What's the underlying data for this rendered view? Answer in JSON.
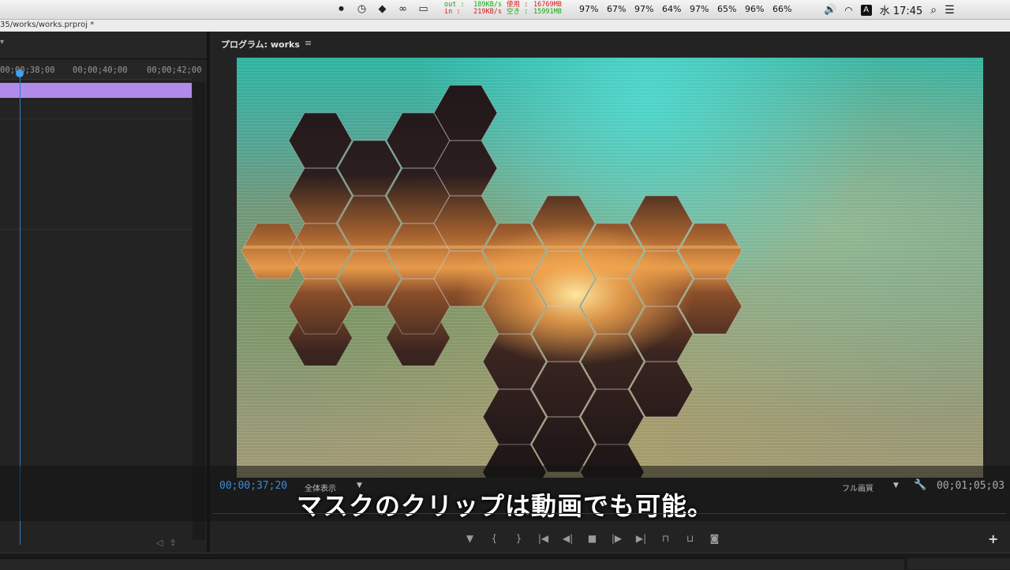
{
  "menubar": {
    "icons": [
      "record-icon",
      "clock-icon",
      "evernote-icon",
      "creative-cloud-icon",
      "airplay-icon"
    ],
    "net_out_label": "out :",
    "net_in_label": "in :",
    "net_out": "189KB/s",
    "net_in": "219KB/s",
    "mem_used_label": "使用 :",
    "mem_free_label": "空き :",
    "mem_used": "16769MB",
    "mem_free": "15991MB",
    "percents": [
      "97%",
      "67%",
      "97%",
      "64%",
      "97%",
      "65%",
      "96%",
      "66%"
    ],
    "input_badge": "A",
    "clock": "水 17:45"
  },
  "titlebar": {
    "path": "35/works/works.prproj *"
  },
  "timeline": {
    "ticks": [
      "00;00;38;00",
      "00;00;40;00",
      "00;00;42;00"
    ]
  },
  "program": {
    "title": "プログラム: works",
    "menu_icon": "≡",
    "timecode_current": "00;00;37;20",
    "fit": "全体表示",
    "quality": "フル画質",
    "timecode_duration": "00;01;05;03"
  },
  "subtitle": "マスクのクリップは動画でも可能。",
  "colors": {
    "clip_purple": "#b18bea",
    "playhead_blue": "#3fa2f2",
    "timecode_blue": "#3d8bd9"
  }
}
